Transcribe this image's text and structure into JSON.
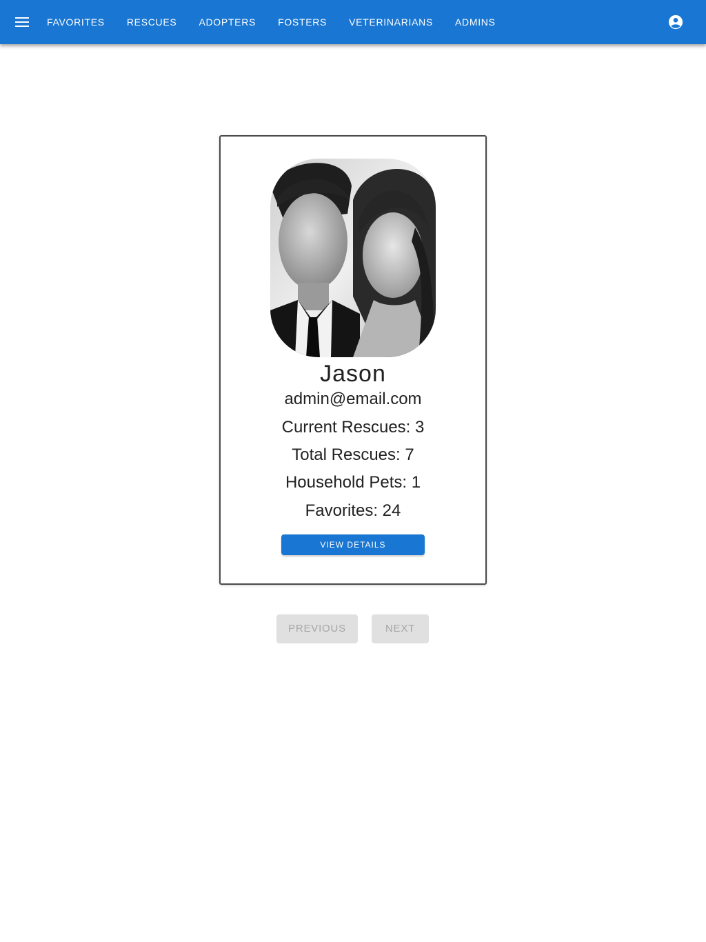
{
  "nav": {
    "menu_icon": "hamburger-menu-icon",
    "items": [
      {
        "label": "FAVORITES"
      },
      {
        "label": "RESCUES"
      },
      {
        "label": "ADOPTERS"
      },
      {
        "label": "FOSTERS"
      },
      {
        "label": "VETERINARIANS"
      },
      {
        "label": "ADMINS"
      }
    ],
    "account_icon": "account-circle-icon"
  },
  "profile": {
    "name": "Jason",
    "email": "admin@email.com",
    "stats": [
      "Current Rescues: 3",
      "Total Rescues: 7",
      "Household Pets: 1",
      "Favorites: 24"
    ],
    "view_details_label": "VIEW DETAILS"
  },
  "pagination": {
    "previous_label": "PREVIOUS",
    "next_label": "NEXT",
    "previous_disabled": true,
    "next_disabled": true
  },
  "colors": {
    "primary": "#1976d2",
    "disabled_bg": "#e0e0e0",
    "disabled_text": "#a6a6a6"
  }
}
